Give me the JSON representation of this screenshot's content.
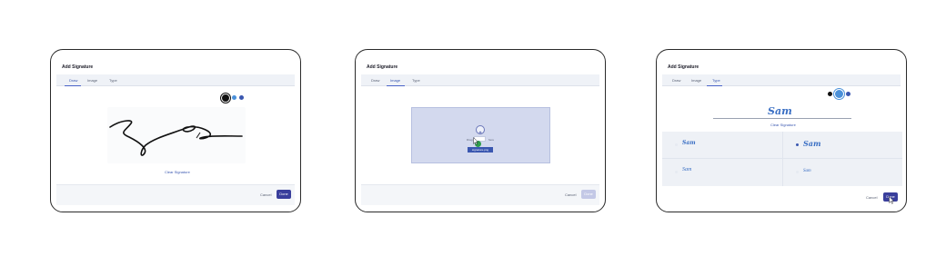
{
  "dialog_title": "Add Signature",
  "tabs": [
    "Draw",
    "Image",
    "Type"
  ],
  "draw": {
    "colors": [
      "#111111",
      "#4a90d9",
      "#3a57b0"
    ],
    "clear_label": "Clear Signature"
  },
  "image": {
    "drop_left": "Drag",
    "drop_right": "here",
    "file_name": "signature.png"
  },
  "type": {
    "colors": [
      "#111111",
      "#4a90d9",
      "#3a57b0"
    ],
    "preview_name": "Sam",
    "clear_label": "Clear Signature",
    "font_samples": [
      "Sam",
      "Sam",
      "Sam",
      "Sam"
    ]
  },
  "footer": {
    "cancel": "Cancel",
    "done": "Done"
  }
}
